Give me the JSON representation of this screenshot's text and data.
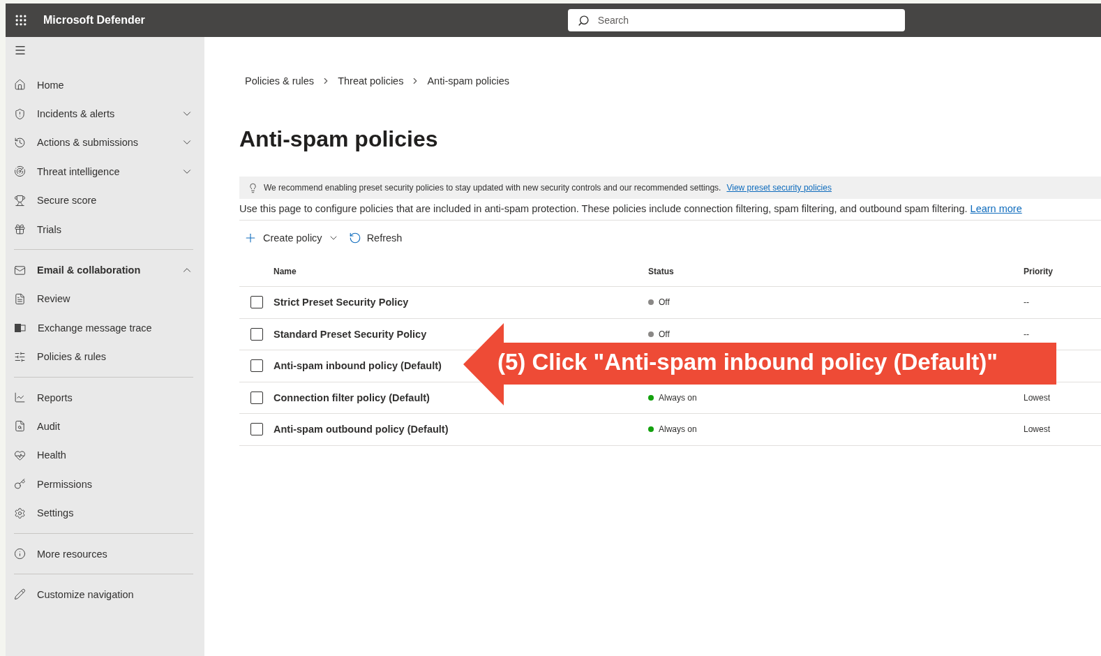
{
  "topbar": {
    "title": "Microsoft Defender",
    "search": {
      "placeholder": "Search"
    }
  },
  "sidebar": {
    "groups": [
      [
        {
          "label": "Home"
        },
        {
          "label": "Incidents & alerts",
          "expanded": false
        },
        {
          "label": "Actions & submissions",
          "expanded": false
        },
        {
          "label": "Threat intelligence",
          "expanded": false
        },
        {
          "label": "Secure score"
        },
        {
          "label": "Trials"
        }
      ],
      [
        {
          "label": "Email & collaboration",
          "expanded": true
        },
        {
          "label": "Review"
        },
        {
          "label": "Exchange message trace"
        },
        {
          "label": "Policies & rules"
        }
      ],
      [
        {
          "label": "Reports"
        },
        {
          "label": "Audit"
        },
        {
          "label": "Health"
        },
        {
          "label": "Permissions"
        },
        {
          "label": "Settings"
        }
      ],
      [
        {
          "label": "More resources"
        }
      ],
      [
        {
          "label": "Customize navigation"
        }
      ]
    ]
  },
  "breadcrumb": [
    "Policies & rules",
    "Threat policies",
    "Anti-spam policies"
  ],
  "page_title": "Anti-spam policies",
  "notice": {
    "text": "We recommend enabling preset security policies to stay updated with new security controls and our recommended settings.",
    "link": "View preset security policies"
  },
  "description": {
    "text": "Use this page to configure policies that are included in anti-spam protection. These policies include connection filtering, spam filtering, and outbound spam filtering.",
    "link": "Learn more"
  },
  "toolbar": {
    "create": "Create policy",
    "refresh": "Refresh"
  },
  "table": {
    "columns": [
      "Name",
      "Status",
      "Priority"
    ],
    "rows": [
      {
        "name": "Strict Preset Security Policy",
        "checked": false,
        "status": "Off",
        "color": "#8a8886",
        "priority": "--"
      },
      {
        "name": "Standard Preset Security Policy",
        "checked": false,
        "status": "Off",
        "color": "#8a8886",
        "priority": "--"
      },
      {
        "name": "Anti-spam inbound policy (Default)",
        "checked": false
      },
      {
        "name": "Connection filter policy (Default)",
        "checked": false,
        "status": "Always on",
        "color": "#13a10e",
        "priority": "Lowest"
      },
      {
        "name": "Anti-spam outbound policy (Default)",
        "checked": false,
        "status": "Always on",
        "color": "#13a10e",
        "priority": "Lowest"
      }
    ]
  },
  "callout": {
    "text": "(5) Click \"Anti-spam inbound policy (Default)\""
  }
}
